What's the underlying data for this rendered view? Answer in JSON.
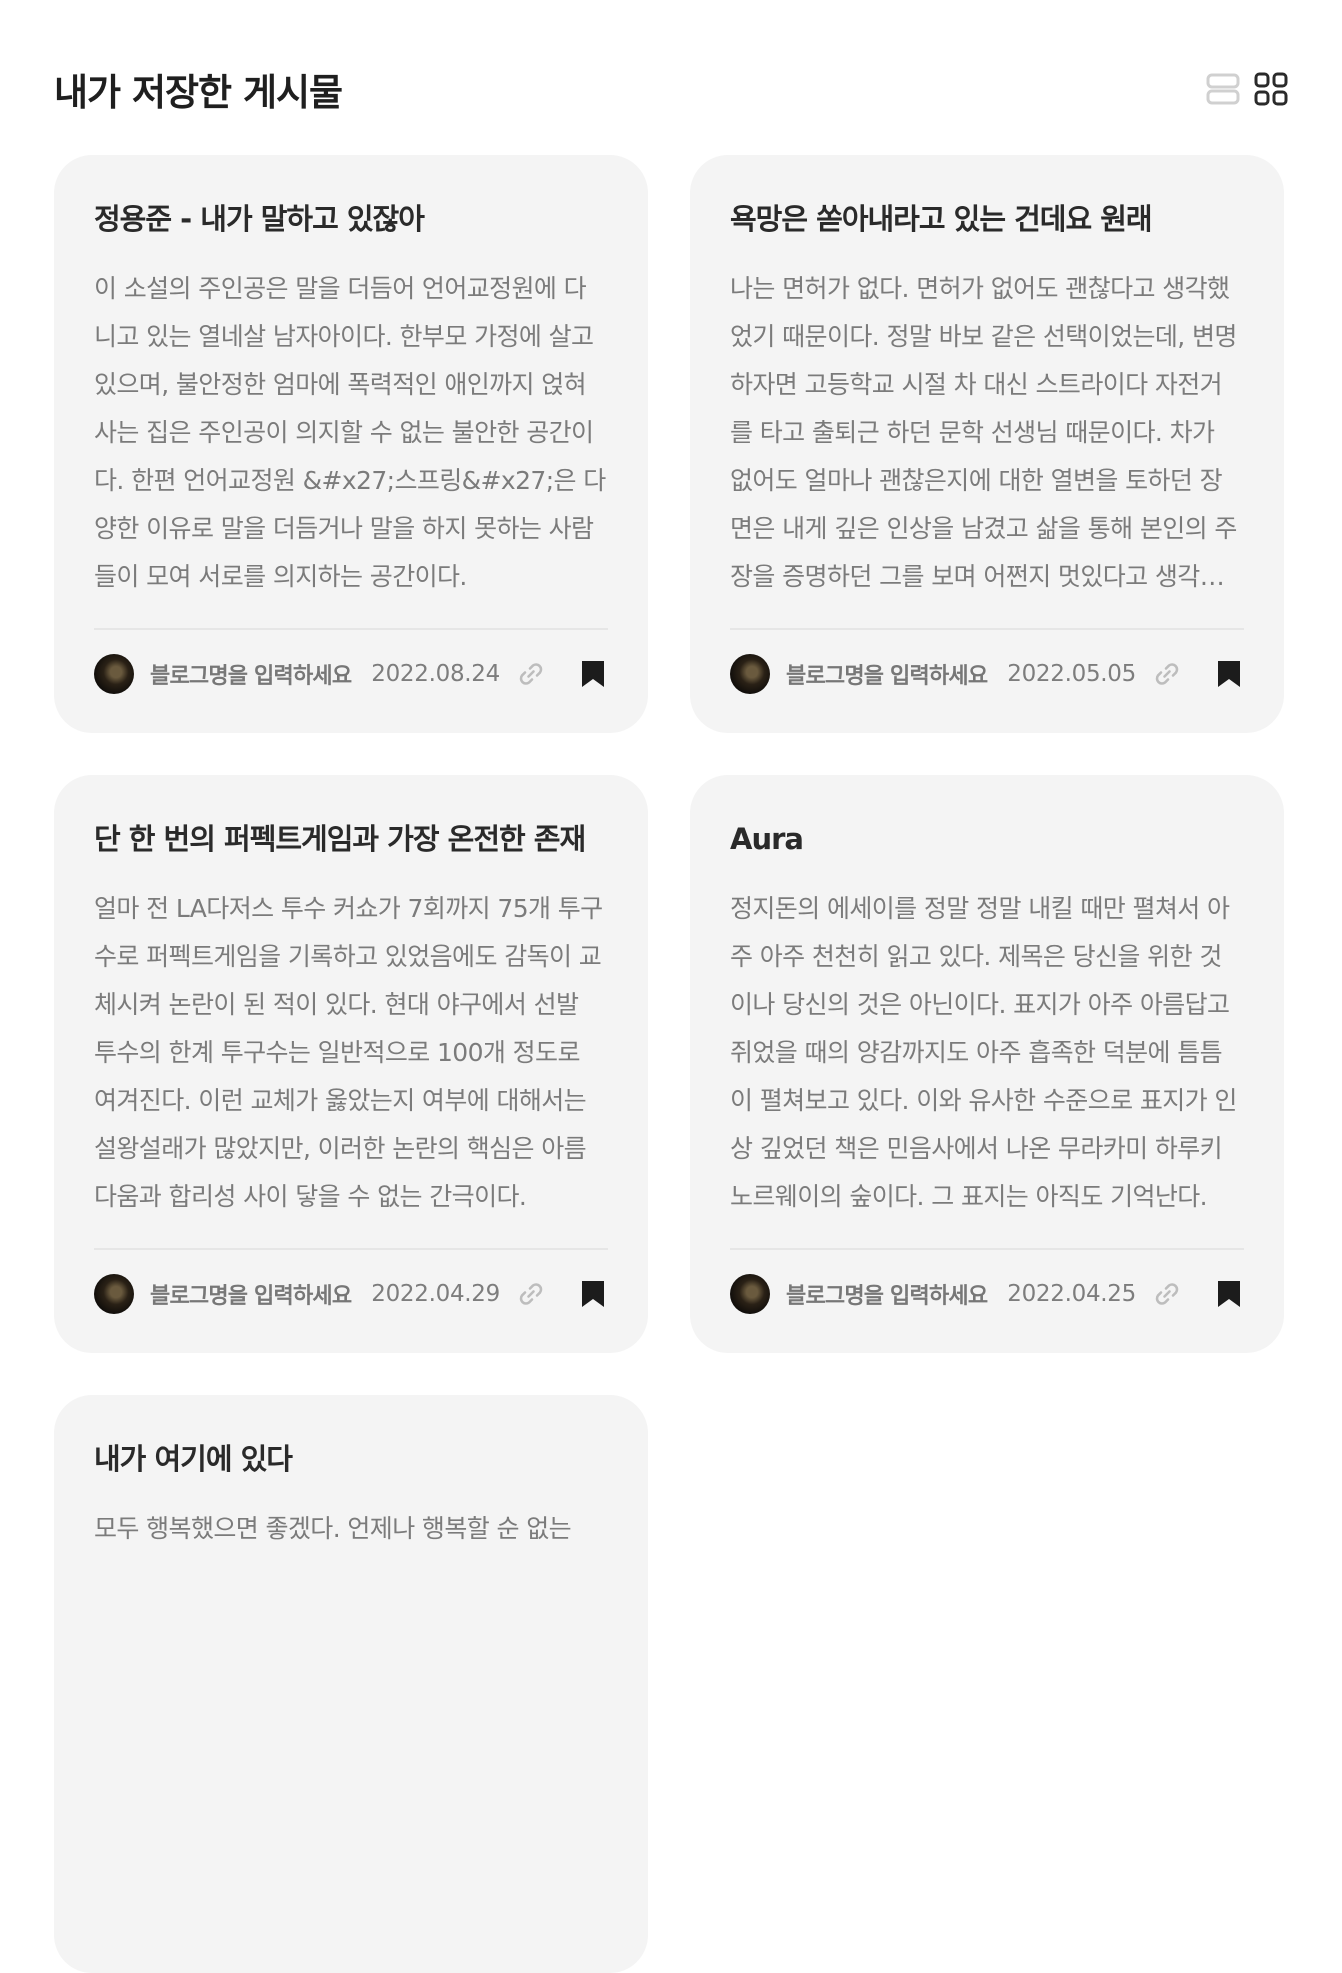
{
  "page": {
    "title": "내가 저장한 게시물"
  },
  "view_toggle": {
    "list_icon": "list-view-icon",
    "grid_icon": "grid-view-icon"
  },
  "cards": [
    {
      "title": "정용준 - 내가 말하고 있잖아",
      "excerpt": "이 소설의 주인공은 말을 더듬어 언어교정원에 다니고 있는 열네살 남자아이다. 한부모 가정에 살고 있으며, 불안정한 엄마에 폭력적인 애인까지 얹혀사는 집은 주인공이 의지할 수 없는 불안한 공간이다. 한편 언어교정원 &#x27;스프링&#x27;은 다양한 이유로 말을 더듬거나 말을 하지 못하는 사람들이 모여 서로를 의지하는 공간이다.",
      "blog_name": "블로그명을 입력하세요",
      "date": "2022.08.24"
    },
    {
      "title": "욕망은 쏟아내라고 있는 건데요 원래",
      "excerpt": "나는 면허가 없다. 면허가 없어도 괜찮다고 생각했었기 때문이다. 정말 바보 같은 선택이었는데, 변명하자면 고등학교 시절 차 대신 스트라이다 자전거를 타고 출퇴근 하던 문학 선생님 때문이다. 차가 없어도 얼마나 괜찮은지에 대한 열변을 토하던 장면은 내게 깊은 인상을 남겼고 삶을 통해 본인의 주장을 증명하던 그를 보며 어쩐지 멋있다고 생각했다.",
      "blog_name": "블로그명을 입력하세요",
      "date": "2022.05.05"
    },
    {
      "title": "단 한 번의 퍼펙트게임과 가장 온전한 존재",
      "excerpt": "얼마 전 LA다저스 투수 커쇼가 7회까지 75개 투구수로 퍼펙트게임을 기록하고 있었음에도 감독이 교체시켜 논란이 된 적이 있다. 현대 야구에서 선발 투수의 한계 투구수는 일반적으로 100개 정도로 여겨진다. 이런 교체가 옳았는지 여부에 대해서는 설왕설래가 많았지만, 이러한 논란의 핵심은 아름다움과 합리성 사이 닿을 수 없는 간극이다.",
      "blog_name": "블로그명을 입력하세요",
      "date": "2022.04.29"
    },
    {
      "title": "Aura",
      "excerpt": "정지돈의 에세이를 정말 정말 내킬 때만 펼쳐서 아주 아주 천천히 읽고 있다. 제목은 당신을 위한 것이나 당신의 것은 아닌이다. 표지가 아주 아름답고 쥐었을 때의 양감까지도 아주 흡족한 덕분에 틈틈이 펼쳐보고 있다. 이와 유사한 수준으로 표지가 인상 깊었던 책은 민음사에서 나온 무라카미 하루키 노르웨이의 숲이다. 그 표지는 아직도 기억난다.",
      "blog_name": "블로그명을 입력하세요",
      "date": "2022.04.25"
    },
    {
      "title": "내가 여기에 있다",
      "excerpt": "모두 행복했으면 좋겠다. 언제나 행복할 순 없는",
      "blog_name": "",
      "date": ""
    }
  ],
  "icons": {
    "avatar": "avatar",
    "link": "link-icon",
    "bookmark": "bookmark-filled-icon"
  }
}
